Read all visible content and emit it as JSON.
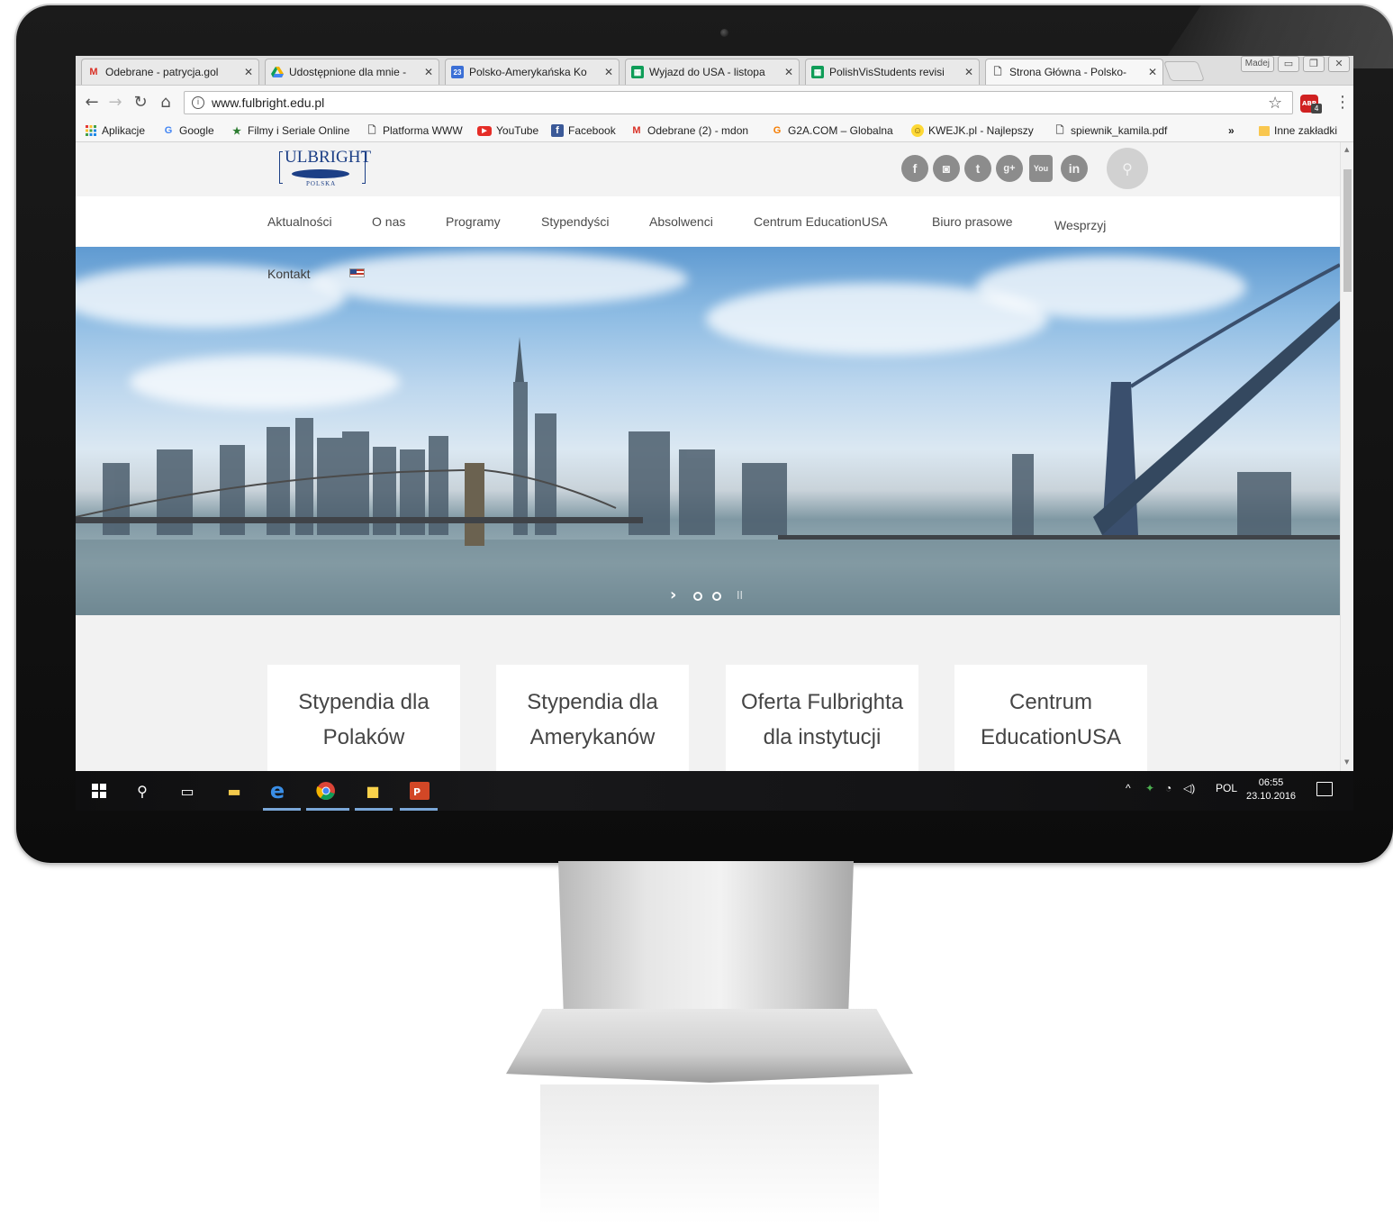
{
  "browser": {
    "tabs": [
      {
        "title": "Odebrane - patrycja.gol",
        "icon": "gmail-icon",
        "active": false
      },
      {
        "title": "Udostępnione dla mnie -",
        "icon": "google-drive-icon",
        "active": false
      },
      {
        "title": "Polsko-Amerykańska Ko",
        "icon": "calendar-icon",
        "icon_text": "23",
        "active": false
      },
      {
        "title": "Wyjazd do USA - listopa",
        "icon": "sheets-icon",
        "active": false
      },
      {
        "title": "PolishVisStudents revisi",
        "icon": "sheets-icon",
        "active": false
      },
      {
        "title": "Strona Główna - Polsko-",
        "icon": "page-icon",
        "active": true
      }
    ],
    "tab_close_glyph": "✕",
    "window_user": "Madej",
    "url": "www.fulbright.edu.pl",
    "bookmarks": [
      {
        "label": "Aplikacje",
        "icon": "apps-grid-icon"
      },
      {
        "label": "Google",
        "icon": "google-icon"
      },
      {
        "label": "Filmy i Seriale Online",
        "icon": "star-icon"
      },
      {
        "label": "Platforma WWW",
        "icon": "page-icon"
      },
      {
        "label": "YouTube",
        "icon": "youtube-icon"
      },
      {
        "label": "Facebook",
        "icon": "facebook-icon"
      },
      {
        "label": "Odebrane (2) - mdon",
        "icon": "gmail-icon"
      },
      {
        "label": "G2A.COM – Globalna",
        "icon": "g2a-icon"
      },
      {
        "label": "KWEJK.pl - Najlepszy",
        "icon": "smiley-icon"
      },
      {
        "label": "spiewnik_kamila.pdf",
        "icon": "page-icon"
      }
    ],
    "bookmarks_overflow": "»",
    "other_bookmarks": "Inne zakładki",
    "abp_badge": "4"
  },
  "site": {
    "logo_text": "ULBRIGHT",
    "logo_sub": "POLSKA",
    "social": [
      {
        "name": "facebook",
        "glyph": "f"
      },
      {
        "name": "instagram",
        "glyph": "◙"
      },
      {
        "name": "twitter",
        "glyph": "t"
      },
      {
        "name": "google-plus",
        "glyph": "g+"
      },
      {
        "name": "youtube",
        "glyph": "You"
      },
      {
        "name": "linkedin",
        "glyph": "in"
      }
    ],
    "nav": [
      "Aktualności",
      "O nas",
      "Programy",
      "Stypendyści",
      "Absolwenci",
      "Centrum EducationUSA",
      "Biuro prasowe",
      "Wesprzyj"
    ],
    "nav_second_row": [
      "Kontakt"
    ],
    "slider_arrow": "›",
    "slider_pause": "II",
    "cards": [
      "Stypendia dla Polaków",
      "Stypendia dla Amerykanów",
      "Oferta Fulbrighta dla instytucji",
      "Centrum EducationUSA"
    ]
  },
  "taskbar": {
    "language": "POL",
    "time": "06:55",
    "date": "23.10.2016"
  },
  "colors": {
    "brand_blue": "#1c3f86",
    "social_grey": "#8c8c8c",
    "taskbar_accent": "#7aa7d8"
  }
}
